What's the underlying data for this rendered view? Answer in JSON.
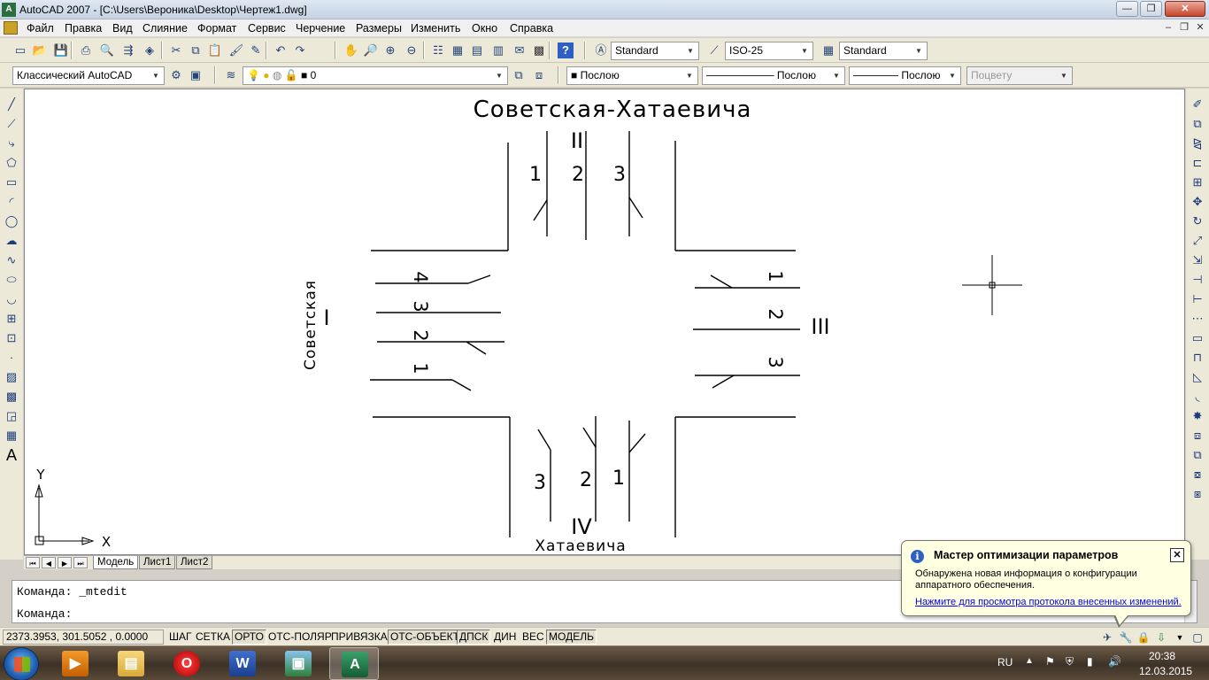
{
  "window": {
    "app_icon": "A",
    "title": "AutoCAD 2007 - [C:\\Users\\Вероника\\Desktop\\Чертеж1.dwg]",
    "minimize_glyph": "—",
    "restore_glyph": "❐",
    "close_glyph": "✕"
  },
  "menubar": {
    "items": [
      "Файл",
      "Правка",
      "Вид",
      "Слияние",
      "Формат",
      "Сервис",
      "Черчение",
      "Размеры",
      "Изменить",
      "Окно",
      "Справка"
    ],
    "doc_min": "–",
    "doc_restore": "❐",
    "doc_close": "✕"
  },
  "toolbar1": {
    "icons": [
      "new-icon",
      "open-icon",
      "save-icon",
      "print-icon",
      "preview-icon",
      "publish-icon",
      "3d-dwf-icon",
      "cut-icon",
      "copy-icon",
      "paste-icon",
      "matchprop-icon",
      "blockedit-icon",
      "undo-icon",
      "redo-icon",
      "pan-icon",
      "zoom-realtime-icon",
      "zoom-window-icon",
      "zoom-previous-icon",
      "properties-icon",
      "designcenter-icon",
      "toolpalettes-icon",
      "sheetset-icon",
      "markup-icon",
      "calculator-icon",
      "help-icon"
    ],
    "text_style": "Standard",
    "dim_style": "ISO-25",
    "table_style": "Standard"
  },
  "toolbar2": {
    "workspace": "Классический AutoCAD",
    "layer": "0",
    "color": "Послою",
    "linetype": "Послою",
    "lineweight": "Послою",
    "plotstyle": "Поцвету"
  },
  "draw_tools": [
    "line-icon",
    "construction-line-icon",
    "polyline-icon",
    "polygon-icon",
    "rectangle-icon",
    "arc-icon",
    "circle-icon",
    "revision-cloud-icon",
    "spline-icon",
    "ellipse-icon",
    "ellipse-arc-icon",
    "insert-block-icon",
    "make-block-icon",
    "point-icon",
    "hatch-icon",
    "gradient-icon",
    "region-icon",
    "table-icon",
    "mtext-icon"
  ],
  "modify_tools": [
    "erase-icon",
    "copy-object-icon",
    "mirror-icon",
    "offset-icon",
    "array-icon",
    "move-icon",
    "rotate-icon",
    "scale-icon",
    "stretch-icon",
    "trim-icon",
    "extend-icon",
    "break-at-point-icon",
    "break-icon",
    "join-icon",
    "chamfer-icon",
    "fillet-icon",
    "explode-icon",
    "draw-order-icon",
    "bring-front-icon",
    "send-back-icon",
    "bring-above-icon"
  ],
  "drawing": {
    "title": "Советская-Хатаевича",
    "north_road": "II",
    "south_road": "IV",
    "west_road": "I",
    "east_road": "III",
    "west_street": "Советская",
    "south_street": "Хатаевича",
    "north_lanes": [
      "1",
      "2",
      "3"
    ],
    "south_lanes": [
      "3",
      "2",
      "1"
    ],
    "west_lanes": [
      "4",
      "3",
      "2",
      "1"
    ],
    "east_lanes": [
      "1",
      "2",
      "3"
    ],
    "ucs_x": "X",
    "ucs_y": "Y"
  },
  "layout_tabs": [
    "Модель",
    "Лист1",
    "Лист2"
  ],
  "command": {
    "history": "Команда:  _mtedit",
    "prompt": "Команда:"
  },
  "status": {
    "coordinates": "2373.3953, 301.5052 , 0.0000",
    "toggles": [
      {
        "label": "ШАГ",
        "on": false
      },
      {
        "label": "СЕТКА",
        "on": false
      },
      {
        "label": "ОРТО",
        "on": true
      },
      {
        "label": "ОТС-ПОЛЯР",
        "on": false
      },
      {
        "label": "ПРИВЯЗКА",
        "on": false
      },
      {
        "label": "ОТС-ОБЪЕКТ",
        "on": true
      },
      {
        "label": "ДПСК",
        "on": true
      },
      {
        "label": "ДИН",
        "on": false
      },
      {
        "label": "ВЕС",
        "on": false
      },
      {
        "label": "МОДЕЛЬ",
        "on": true
      }
    ]
  },
  "balloon": {
    "title": "Мастер оптимизации параметров",
    "text": "Обнаружена новая информация о конфигурации аппаратного обеспечения.",
    "link": "Нажмите для просмотра протокола внесенных изменений."
  },
  "taskbar": {
    "apps": [
      "media-player-icon",
      "explorer-icon",
      "opera-icon",
      "word-icon",
      "photo-viewer-icon",
      "autocad-icon"
    ],
    "word_letter": "W",
    "acad_letter": "A",
    "opera_letter": "O",
    "lang": "RU",
    "time": "20:38",
    "date": "12.03.2015"
  }
}
